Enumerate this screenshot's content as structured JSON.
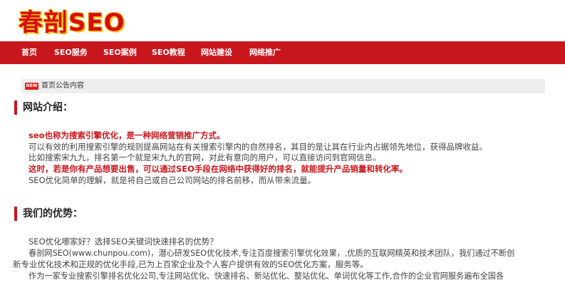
{
  "header": {
    "logo_text": "春剖SEO"
  },
  "nav": {
    "items": [
      {
        "label": "首页"
      },
      {
        "label": "SEO服务"
      },
      {
        "label": "SEO案例"
      },
      {
        "label": "SEO教程"
      },
      {
        "label": "网站建设"
      },
      {
        "label": "网络推广"
      }
    ]
  },
  "notice": {
    "badge": "NEW",
    "text": "首页公告内容"
  },
  "intro": {
    "title": "网站介绍：",
    "lines": [
      "seo也称为搜索引擎优化，是一种网络营销推广方式。",
      "可以有效的利用搜索引擎的规则提高网站在有关搜索引擎内的自然排名，其目的是让其在行业内占据领先地位，获得品牌收益。",
      "比如搜索宋九九，排名第一个就是宋九九的官网，对此有意向的用户，可以直接访问到官网信息。",
      "这时，若是你有产品想要出售，可以通过SEO手段在网络中获得好的排名，就能提升产品销量和转化率。",
      "SEO优化简单的理解，就是将自己或自己公司网站的排名前移，而从带来流量。"
    ]
  },
  "advantages": {
    "title": "我们的优势：",
    "lines": [
      "SEO优化哪家好？选择SEO关键词快速排名的优势？",
      "春剖网SEO(www.chunpou.com)，潜心研发SEO优化技术,专注百度搜索引擎优化效果，,优质的互联网精英和技术团队，我们通过不断创",
      "新专业优化技术和正规的优化手段,已为上百家企业及个人客户提供有效的SEO优化方案，服务等。",
      "作为一家专业搜索引擎排名优化公司,专注网站优化、快速排名、新站优化、整站优化、单词优化等工作,合作的企业官网服务遍布全国各"
    ]
  },
  "colors": {
    "brand_red": "#c8161d",
    "logo_outline": "#f4c21a"
  }
}
